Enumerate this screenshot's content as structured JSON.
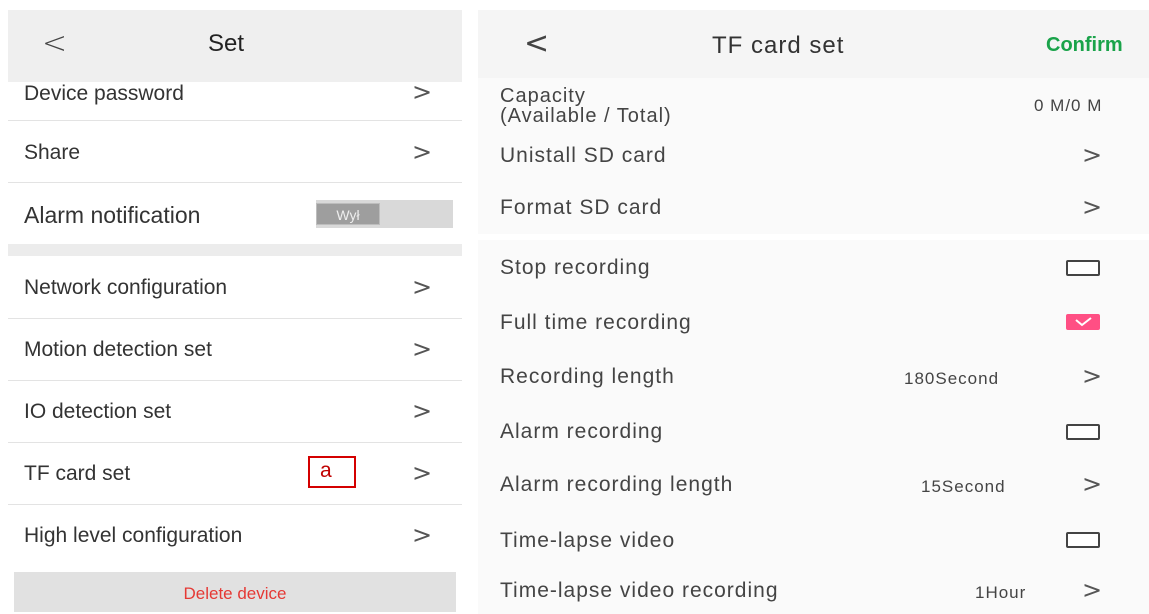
{
  "left": {
    "header": {
      "title": "Set",
      "back_icon": "chevron-left-icon"
    },
    "items": [
      {
        "label": "Device password"
      },
      {
        "label": "Share"
      },
      {
        "label": "Alarm notification",
        "toggle": "Wył"
      },
      {
        "label": "Network configuration"
      },
      {
        "label": "Motion detection set"
      },
      {
        "label": "IO detection set"
      },
      {
        "label": "TF card set"
      },
      {
        "label": "High level configuration"
      }
    ],
    "marker_label": "a",
    "delete_label": "Delete device",
    "chevron": ">"
  },
  "right": {
    "header": {
      "title": "TF card set",
      "confirm": "Confirm",
      "back": "<"
    },
    "capacity": {
      "label_line1": "Capacity",
      "label_line2": "(Available / Total)",
      "value": "0 M/0 M"
    },
    "rows": {
      "uninstall": "Unistall SD card",
      "format": "Format SD card",
      "stop": "Stop recording",
      "full_time": "Full time recording",
      "rec_length": "Recording length",
      "rec_length_value": "180Second",
      "alarm": "Alarm recording",
      "alarm_length": "Alarm recording length",
      "alarm_length_value": "15Second",
      "timelapse": "Time-lapse video",
      "timelapse_rec": "Time-lapse video recording",
      "timelapse_rec_value": "1Hour"
    },
    "checked": {
      "stop": false,
      "full_time": true,
      "alarm": false,
      "timelapse": false
    },
    "accent": "#ff4f84",
    "confirm_color": "#1aa34a"
  }
}
